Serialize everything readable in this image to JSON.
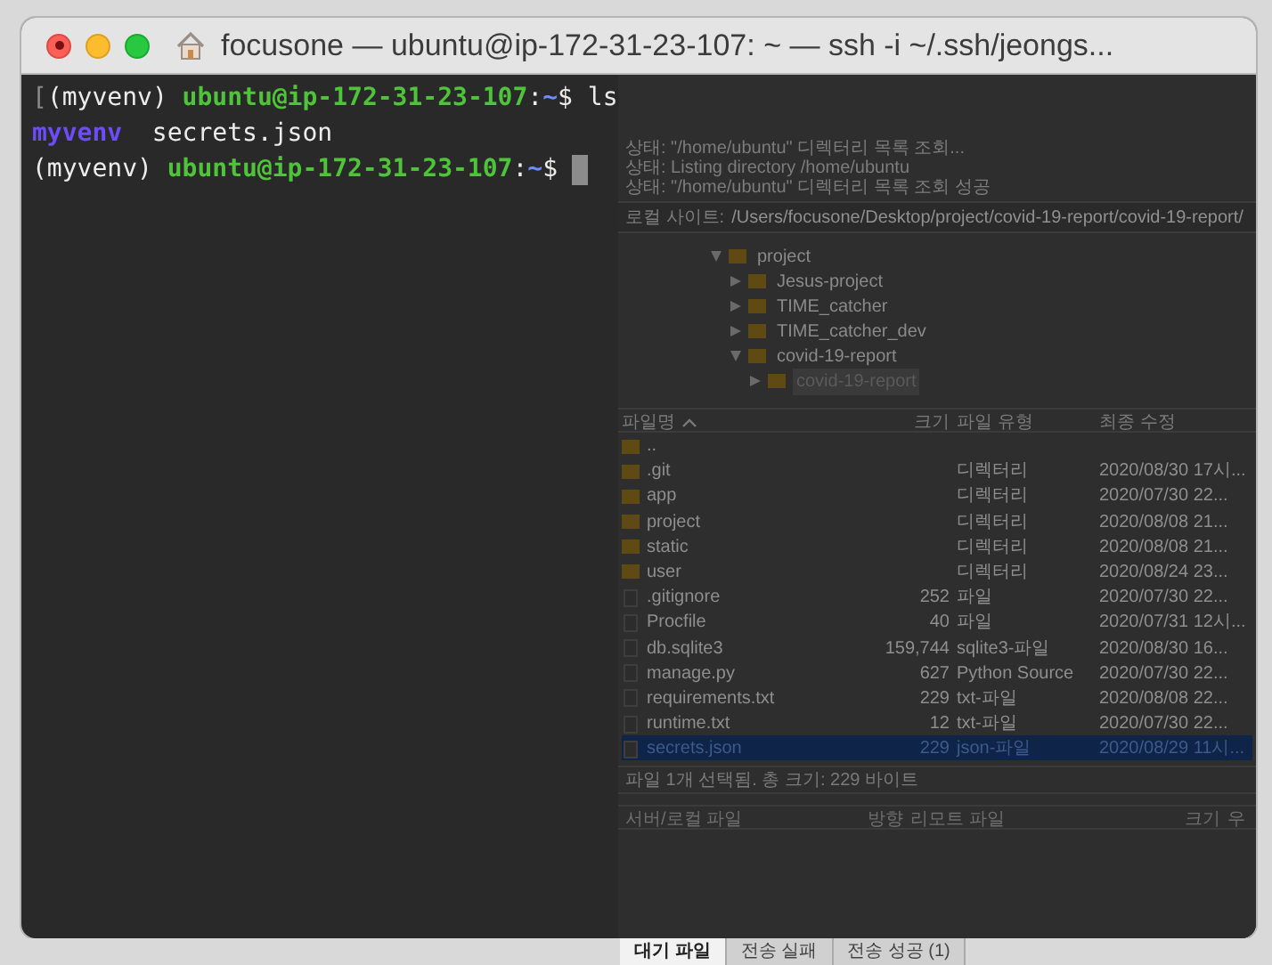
{
  "window": {
    "title": "focusone — ubuntu@ip-172-31-23-107: ~ — ssh -i ~/.ssh/jeongs..."
  },
  "terminal": {
    "lines": [
      {
        "cursor": false,
        "segments": [
          {
            "text": "[",
            "kind": "mark"
          },
          {
            "text": "(myvenv) ",
            "kind": "plain"
          },
          {
            "text": "ubuntu@ip-172-31-23-107",
            "kind": "host"
          },
          {
            "text": ":",
            "kind": "plain"
          },
          {
            "text": "~",
            "kind": "path"
          },
          {
            "text": "$ ls",
            "kind": "plain"
          }
        ]
      },
      {
        "cursor": false,
        "segments": [
          {
            "text": "myvenv",
            "kind": "dir"
          },
          {
            "text": "  secrets.json",
            "kind": "plain"
          }
        ]
      },
      {
        "cursor": true,
        "segments": [
          {
            "text": "(myvenv) ",
            "kind": "plain"
          },
          {
            "text": "ubuntu@ip-172-31-23-107",
            "kind": "host"
          },
          {
            "text": ":",
            "kind": "plain"
          },
          {
            "text": "~",
            "kind": "path"
          },
          {
            "text": "$ ",
            "kind": "plain"
          }
        ]
      }
    ]
  },
  "background_app": {
    "status_log": [
      "상태:  \"/home/ubuntu\" 디렉터리 목록 조회...",
      "상태:  Listing directory /home/ubuntu",
      "상태:  \"/home/ubuntu\" 디렉터리 목록 조회 성공"
    ],
    "local_site": {
      "label": "로컬 사이트:",
      "path": "/Users/focusone/Desktop/project/covid-19-report/covid-19-report/"
    },
    "tree": [
      {
        "label": "project",
        "expanded": true,
        "selected": false,
        "children": [
          {
            "label": "Jesus-project",
            "expanded": false,
            "selected": false
          },
          {
            "label": "TIME_catcher",
            "expanded": false,
            "selected": false
          },
          {
            "label": "TIME_catcher_dev",
            "expanded": false,
            "selected": false
          },
          {
            "label": "covid-19-report",
            "expanded": true,
            "selected": false,
            "children": [
              {
                "label": "covid-19-report",
                "expanded": false,
                "selected": true
              }
            ]
          }
        ]
      }
    ],
    "file_table": {
      "columns": [
        "파일명",
        "크기",
        "파일 유형",
        "최종 수정"
      ],
      "rows": [
        {
          "kind": "folder",
          "name": "..",
          "size": "",
          "type": "",
          "modified": "",
          "selected": false
        },
        {
          "kind": "folder",
          "name": ".git",
          "size": "",
          "type": "디렉터리",
          "modified": "2020/08/30 17시...",
          "selected": false
        },
        {
          "kind": "folder",
          "name": "app",
          "size": "",
          "type": "디렉터리",
          "modified": "2020/07/30 22...",
          "selected": false
        },
        {
          "kind": "folder",
          "name": "project",
          "size": "",
          "type": "디렉터리",
          "modified": "2020/08/08 21...",
          "selected": false
        },
        {
          "kind": "folder",
          "name": "static",
          "size": "",
          "type": "디렉터리",
          "modified": "2020/08/08 21...",
          "selected": false
        },
        {
          "kind": "folder",
          "name": "user",
          "size": "",
          "type": "디렉터리",
          "modified": "2020/08/24 23...",
          "selected": false
        },
        {
          "kind": "file",
          "name": ".gitignore",
          "size": "252",
          "type": "파일",
          "modified": "2020/07/30 22...",
          "selected": false
        },
        {
          "kind": "file",
          "name": "Procfile",
          "size": "40",
          "type": "파일",
          "modified": "2020/07/31 12시...",
          "selected": false
        },
        {
          "kind": "file",
          "name": "db.sqlite3",
          "size": "159,744",
          "type": "sqlite3-파일",
          "modified": "2020/08/30 16...",
          "selected": false
        },
        {
          "kind": "file",
          "name": "manage.py",
          "size": "627",
          "type": "Python Source",
          "modified": "2020/07/30 22...",
          "selected": false
        },
        {
          "kind": "file",
          "name": "requirements.txt",
          "size": "229",
          "type": "txt-파일",
          "modified": "2020/08/08 22...",
          "selected": false
        },
        {
          "kind": "file",
          "name": "runtime.txt",
          "size": "12",
          "type": "txt-파일",
          "modified": "2020/07/30 22...",
          "selected": false
        },
        {
          "kind": "file",
          "name": "secrets.json",
          "size": "229",
          "type": "json-파일",
          "modified": "2020/08/29 11시...",
          "selected": true
        }
      ]
    },
    "selection_status": "파일 1개 선택됨. 총 크기: 229 바이트",
    "queue_columns": [
      "서버/로컬 파일",
      "방향",
      "리모트 파일",
      "크기",
      "우"
    ],
    "queue_tabs": [
      {
        "label": "대기 파일",
        "selected": true
      },
      {
        "label": "전송 실패",
        "selected": false
      },
      {
        "label": "전송 성공 (1)",
        "selected": false
      }
    ]
  }
}
